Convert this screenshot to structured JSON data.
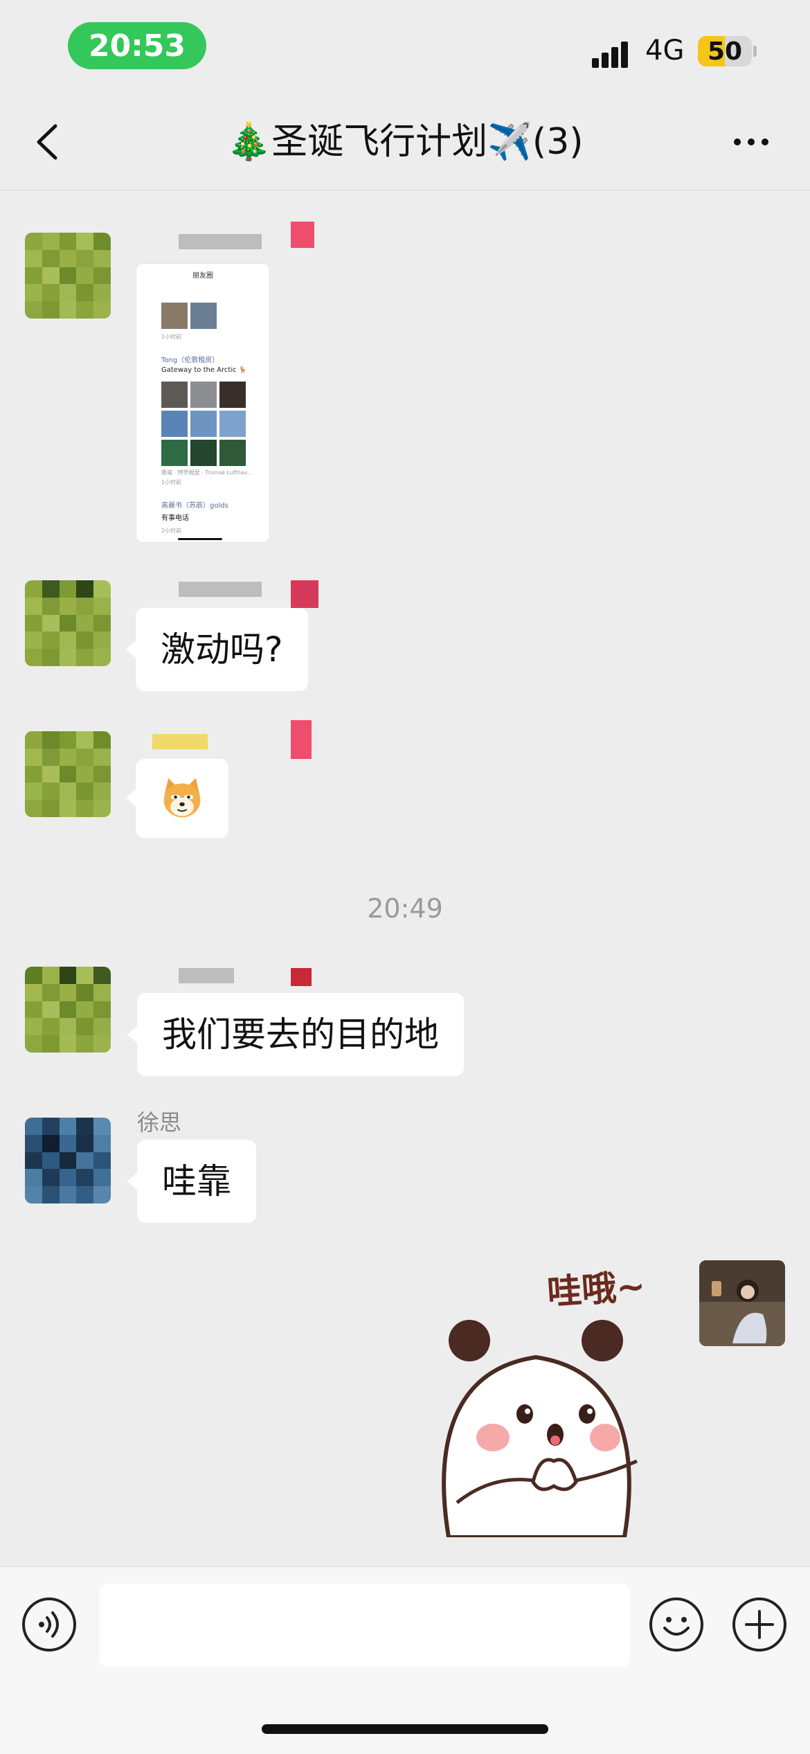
{
  "status_bar": {
    "time": "20:53",
    "network": "4G",
    "battery": "50",
    "battery_level": 0.5
  },
  "nav": {
    "title": "🎄圣诞飞行计划✈️(3)",
    "back_icon": "chevron-left-icon",
    "more_icon": "more-dots-icon"
  },
  "shared_screenshot": {
    "title": "朋友圈",
    "meta1": "1小时前",
    "post_author": "Tong（伦敦租房）",
    "post_text": "Gateway to the Arctic 🦌",
    "location": "挪威 · 特罗姆瑟 · Tromsø Lufthav...",
    "meta2": "1小时前",
    "post2_author": "高晨书（苏辰）golds",
    "post2_text": "有事电话",
    "meta3": "2小时前"
  },
  "messages": [
    {
      "type": "text",
      "text": "激动吗?"
    },
    {
      "type": "emoji",
      "icon": "shiba-dog-emoji-icon"
    },
    {
      "type": "timestamp",
      "text": "20:49"
    },
    {
      "type": "text",
      "text": "我们要去的目的地"
    },
    {
      "type": "text",
      "sender": "徐思",
      "text": "哇靠"
    },
    {
      "type": "sticker",
      "text": "哇哦~",
      "icon": "panda-sticker-icon"
    }
  ],
  "input_bar": {
    "voice_icon": "voice-icon",
    "emoji_icon": "smiley-icon",
    "plus_icon": "plus-icon",
    "placeholder": ""
  },
  "colors": {
    "background": "#ededed",
    "time_pill": "#34c759",
    "battery": "#f5c518",
    "bubble": "#ffffff"
  }
}
